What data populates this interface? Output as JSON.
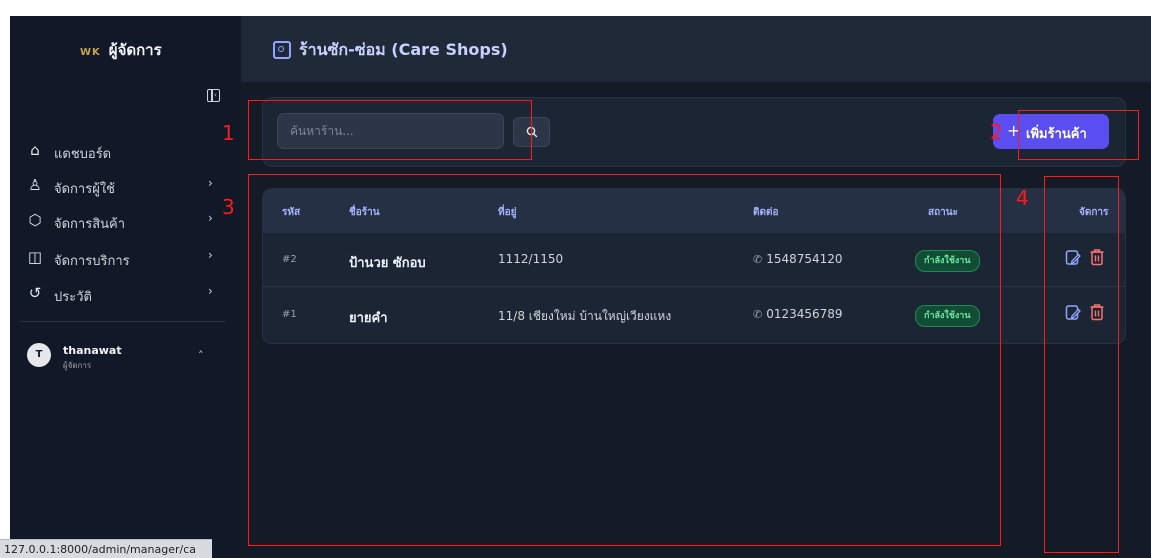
{
  "brand": {
    "logo_text": "WK",
    "title": "ผู้จัดการ"
  },
  "sidebar": {
    "items": [
      {
        "label": "แดชบอร์ด",
        "icon": "home-icon",
        "has_chevron": false
      },
      {
        "label": "จัดการผู้ใช้",
        "icon": "users-icon",
        "has_chevron": true
      },
      {
        "label": "จัดการสินค้า",
        "icon": "box-icon",
        "has_chevron": true
      },
      {
        "label": "จัดการบริการ",
        "icon": "service-icon",
        "has_chevron": true
      },
      {
        "label": "ประวัติ",
        "icon": "history-icon",
        "has_chevron": true
      }
    ],
    "user": {
      "initial": "T",
      "name": "thanawat",
      "role": "ผู้จัดการ"
    }
  },
  "header": {
    "title": "ร้านซัก-ซ่อม (Care Shops)",
    "icon": "shop-icon"
  },
  "search": {
    "placeholder": "ค้นหาร้าน...",
    "value": ""
  },
  "actions": {
    "add_label": "เพิ่มร้านค้า"
  },
  "table": {
    "columns": [
      "รหัส",
      "ชื่อร้าน",
      "ที่อยู่",
      "ติดต่อ",
      "สถานะ",
      "จัดการ"
    ],
    "rows": [
      {
        "code": "#2",
        "name": "ป้านวย ซักอบ",
        "address": "1112/1150",
        "phone": "1548754120",
        "status": "กำลังใช้งาน"
      },
      {
        "code": "#1",
        "name": "ยายคำ",
        "address": "11/8 เชียงใหม่ บ้านใหญ่เวียงแหง",
        "phone": "0123456789",
        "status": "กำลังใช้งาน"
      }
    ]
  },
  "annotations": [
    "1",
    "2",
    "3",
    "4"
  ],
  "statusbar": {
    "url": "127.0.0.1:8000/admin/manager/ca"
  },
  "colors": {
    "accent": "#5b4ef0",
    "status_active": "#6ee7a5",
    "annotation": "#ff1a1a",
    "delete": "#f87171",
    "edit": "#93a4ff"
  }
}
